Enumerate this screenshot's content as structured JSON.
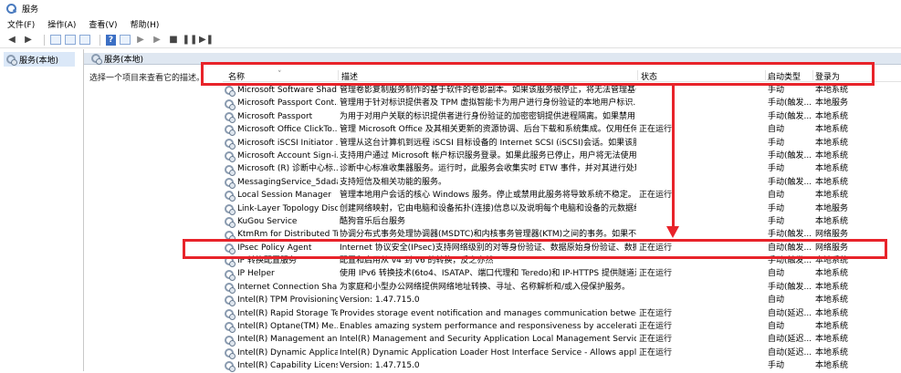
{
  "window": {
    "title": "服务"
  },
  "menu": [
    "文件(F)",
    "操作(A)",
    "查看(V)",
    "帮助(H)"
  ],
  "tree": {
    "root": "服务(本地)"
  },
  "main": {
    "header": "服务(本地)",
    "description_prompt": "选择一个项目来查看它的描述。",
    "columns": {
      "name": "名称",
      "desc": "描述",
      "status": "状态",
      "start": "启动类型",
      "logon": "登录为"
    },
    "rows": [
      {
        "name": "Microsoft Software Shad...",
        "desc": "管理卷影复制服务制作的基于软件的卷影副本。如果该服务被停止，将无法管理基于...",
        "status": "",
        "start": "手动",
        "logon": "本地系统"
      },
      {
        "name": "Microsoft Passport Cont...",
        "desc": "管理用于针对标识提供者及 TPM 虚拟智能卡为用户进行身份验证的本地用户标识...",
        "status": "",
        "start": "手动(触发...",
        "logon": "本地服务"
      },
      {
        "name": "Microsoft Passport",
        "desc": "为用于对用户关联的标识提供者进行身份验证的加密密钥提供进程隔离。如果禁用了...",
        "status": "",
        "start": "手动(触发...",
        "logon": "本地系统"
      },
      {
        "name": "Microsoft Office ClickTo...",
        "desc": "管理 Microsoft Office 及其相关更新的资源协调、后台下载和系统集成。仅用任何 ...",
        "status": "正在运行",
        "start": "自动",
        "logon": "本地系统"
      },
      {
        "name": "Microsoft iSCSI Initiator ...",
        "desc": "管理从这台计算机到远程 iSCSI 目标设备的 Internet SCSI (iSCSI)会话。如果该服务...",
        "status": "",
        "start": "手动",
        "logon": "本地系统"
      },
      {
        "name": "Microsoft Account Sign-i...",
        "desc": "支持用户通过 Microsoft 帐户标识服务登录。如果此服务已停止，用户将无法使用...",
        "status": "",
        "start": "手动(触发...",
        "logon": "本地系统"
      },
      {
        "name": "Microsoft (R) 诊断中心标...",
        "desc": "诊断中心标准收集器服务。运行时，此服务会收集实时 ETW 事件，并对其进行处理。",
        "status": "",
        "start": "手动",
        "logon": "本地系统"
      },
      {
        "name": "MessagingService_5dada",
        "desc": "支持短信及相关功能的服务。",
        "status": "",
        "start": "手动(触发...",
        "logon": "本地系统"
      },
      {
        "name": "Local Session Manager",
        "desc": "管理本地用户会话的核心 Windows 服务。停止或禁用此服务将导致系统不稳定。",
        "status": "正在运行",
        "start": "自动",
        "logon": "本地系统"
      },
      {
        "name": "Link-Layer Topology Disc...",
        "desc": "创建网络映射，它由电脑和设备拓扑(连接)信息以及说明每个电脑和设备的元数据组...",
        "status": "",
        "start": "手动",
        "logon": "本地服务"
      },
      {
        "name": "KuGou Service",
        "desc": "酷狗音乐后台服务",
        "status": "",
        "start": "手动",
        "logon": "本地系统"
      },
      {
        "name": "KtmRm for Distributed Tr...",
        "desc": "协调分布式事务处理协调器(MSDTC)和内核事务管理器(KTM)之间的事务。如果不要...",
        "status": "",
        "start": "手动(触发...",
        "logon": "网络服务"
      },
      {
        "name": "IPsec Policy Agent",
        "desc": "Internet 协议安全(IPsec)支持网络级别的对等身份验证、数据原始身份验证、数据完...",
        "status": "正在运行",
        "start": "自动(触发...",
        "logon": "网络服务"
      },
      {
        "name": "IP 转换配置服务",
        "desc": "配置和启用从 v4 到 v6 的转换，反之亦然",
        "status": "",
        "start": "手动(触发...",
        "logon": "本地系统"
      },
      {
        "name": "IP Helper",
        "desc": "使用 IPv6 转换技术(6to4、ISATAP、端口代理和 Teredo)和 IP-HTTPS 提供隧道连...",
        "status": "正在运行",
        "start": "自动",
        "logon": "本地系统"
      },
      {
        "name": "Internet Connection Shari...",
        "desc": "为家庭和小型办公网络提供网络地址转换、寻址、名称解析和/或入侵保护服务。",
        "status": "",
        "start": "手动(触发...",
        "logon": "本地系统"
      },
      {
        "name": "Intel(R) TPM Provisioning...",
        "desc": "Version: 1.47.715.0",
        "status": "",
        "start": "自动",
        "logon": "本地系统"
      },
      {
        "name": "Intel(R) Rapid Storage Te...",
        "desc": "Provides storage event notification and manages communication between th...",
        "status": "正在运行",
        "start": "自动(延迟...",
        "logon": "本地系统"
      },
      {
        "name": "Intel(R) Optane(TM) Me...",
        "desc": "Enables amazing system performance and responsiveness by accelerating fr...",
        "status": "正在运行",
        "start": "自动",
        "logon": "本地系统"
      },
      {
        "name": "Intel(R) Management an...",
        "desc": "Intel(R) Management and Security Application Local Management Service - P...",
        "status": "正在运行",
        "start": "自动(延迟...",
        "logon": "本地系统"
      },
      {
        "name": "Intel(R) Dynamic Applicati...",
        "desc": "Intel(R) Dynamic Application Loader Host Interface Service - Allows applicatio...",
        "status": "正在运行",
        "start": "自动(延迟...",
        "logon": "本地系统"
      },
      {
        "name": "Intel(R) Capability Licensi...",
        "desc": "Version: 1.47.715.0",
        "status": "",
        "start": "手动",
        "logon": "本地系统"
      }
    ]
  },
  "colors": {
    "highlight": "#e8232a",
    "header_bg": "#dfe7f1",
    "tree_selected": "#dbe8f8"
  }
}
